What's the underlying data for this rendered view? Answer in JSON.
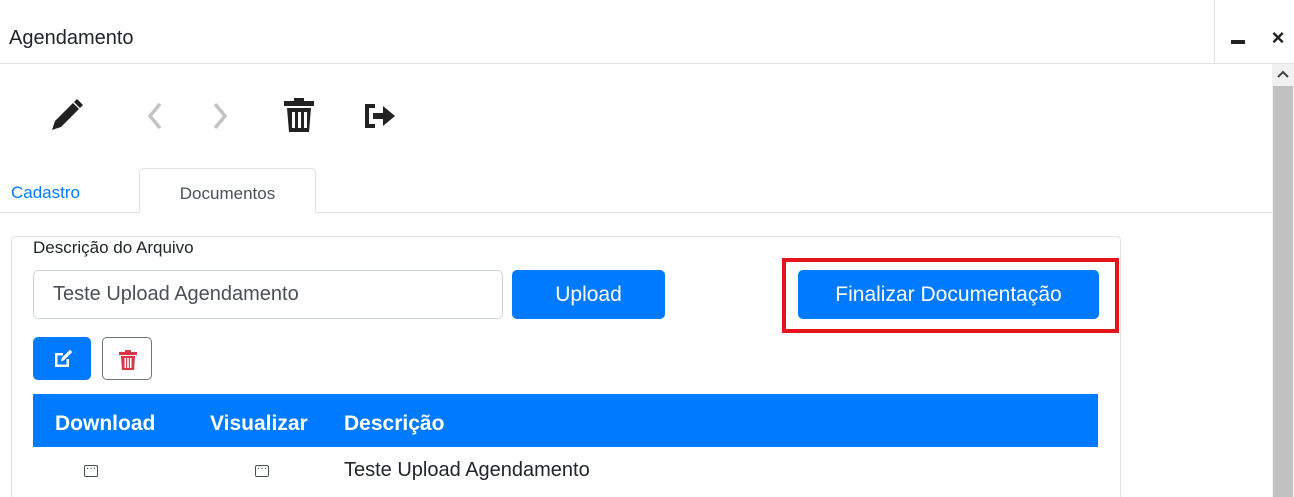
{
  "window": {
    "title": "Agendamento",
    "minimize_label": "",
    "close_label": "×"
  },
  "toolbar": {
    "icons": [
      "pencil-icon",
      "chevron-left-icon",
      "chevron-right-icon",
      "trash-icon",
      "sign-out-icon"
    ]
  },
  "tabs": [
    {
      "label": "Cadastro",
      "active": false
    },
    {
      "label": "Documentos",
      "active": true
    }
  ],
  "form": {
    "description_label": "Descrição do Arquivo",
    "description_value": "Teste Upload Agendamento",
    "upload_label": "Upload",
    "finalize_label": "Finalizar Documentação"
  },
  "actions": {
    "edit_icon": "edit-icon",
    "delete_icon": "trash-icon"
  },
  "grid": {
    "columns": [
      "Download",
      "Visualizar",
      "Descrição"
    ],
    "rows": [
      {
        "download_icon": "ellipsis-icon",
        "view_icon": "ellipsis-icon",
        "description": "Teste Upload Agendamento"
      }
    ]
  },
  "colors": {
    "primary": "#007bff",
    "highlight": "#e3141b",
    "danger": "#dc3545",
    "icon_dark": "#222222",
    "icon_light": "#c4c4c4"
  }
}
